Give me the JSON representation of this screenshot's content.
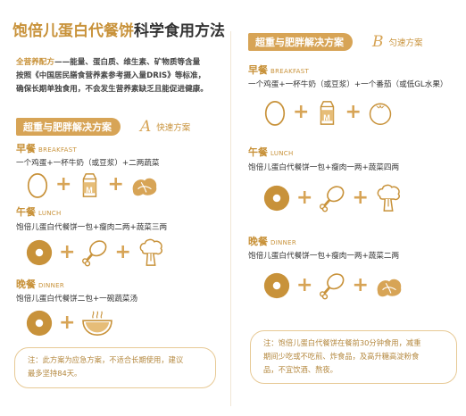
{
  "title": {
    "part1": "饱倍儿蛋白代餐饼",
    "part2": "科学食用方法"
  },
  "intro": {
    "highlight": "全营养配方",
    "line1_rest": "——能量、蛋白质、维生素、矿物质等含量",
    "line2": "按照《中国居民膳食营养素参考摄入量DRIS》等标准，",
    "line3": "确保长期单独食用，不会发生营养素缺乏且能促进健康。"
  },
  "plan_a": {
    "banner": "超重与肥胖解决方案",
    "letter": "A",
    "sub": "快速方案",
    "breakfast": {
      "title": "早餐",
      "en": "BREAKFAST",
      "desc": "一个鸡蛋+一杯牛奶（或豆浆）+二两蔬菜"
    },
    "lunch": {
      "title": "午餐",
      "en": "LUNCH",
      "desc": "饱倍儿蛋白代餐饼一包+瘦肉二两+蔬菜三两"
    },
    "dinner": {
      "title": "晚餐",
      "en": "DINNER",
      "desc": "饱倍儿蛋白代餐饼二包+一碗蔬菜汤"
    },
    "note_line1": "注：此方案为应急方案，不适合长期使用，建议",
    "note_line2": "最多坚持84天。"
  },
  "plan_b": {
    "banner": "超重与肥胖解决方案",
    "letter": "B",
    "sub": "匀速方案",
    "breakfast": {
      "title": "早餐",
      "en": "BREAKFAST",
      "desc": "一个鸡蛋+一杯牛奶（或豆浆）+一个番茄（或低GL水果）"
    },
    "lunch": {
      "title": "午餐",
      "en": "LUNCH",
      "desc": "饱倍儿蛋白代餐饼一包+瘦肉一两+蔬菜四两"
    },
    "dinner": {
      "title": "晚餐",
      "en": "DINNER",
      "desc": "饱倍儿蛋白代餐饼一包+瘦肉一两+蔬菜二两"
    },
    "note_line1": "注：饱倍儿蛋白代餐饼在餐前30分钟食用，减重",
    "note_line2": "期间少吃或不吃煎、炸食品，及高升糖高淀粉食",
    "note_line3": "品，不宜饮酒、熬夜。"
  },
  "icon_labels": {
    "milk": "M"
  },
  "colors": {
    "accent": "#c8923a",
    "banner": "#d7a456",
    "icon_fill": "#e6bd78",
    "icon_dark": "#c8923a"
  }
}
